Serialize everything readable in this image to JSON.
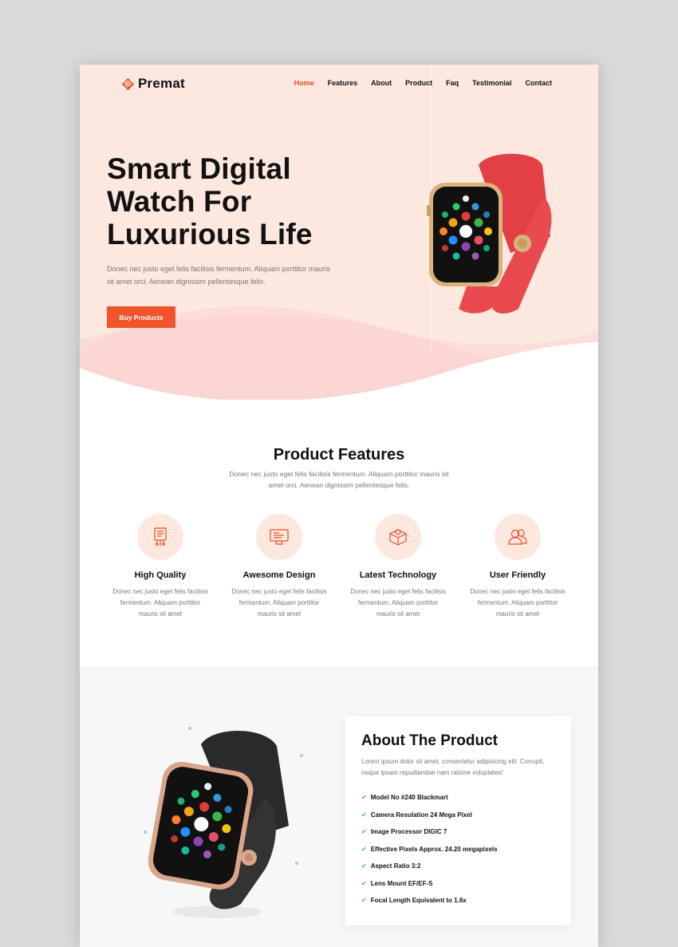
{
  "brand": {
    "name": "Premat",
    "accent": "#ee4d23"
  },
  "nav": {
    "items": [
      {
        "label": "Home",
        "active": true
      },
      {
        "label": "Features",
        "active": false
      },
      {
        "label": "About",
        "active": false
      },
      {
        "label": "Product",
        "active": false
      },
      {
        "label": "Faq",
        "active": false
      },
      {
        "label": "Testimonial",
        "active": false
      },
      {
        "label": "Contact",
        "active": false
      }
    ]
  },
  "hero": {
    "title_line1": "Smart Digital",
    "title_line2": "Watch For",
    "title_line3": "Luxurious Life",
    "description": "Donec nec justo eget felis facilisis fermentum. Aliquam porttitor mauris sit amet orci. Aenean dignissim pellentesque felis.",
    "cta_label": "Buy Products"
  },
  "features": {
    "title": "Product Features",
    "description": "Donec nec justo eget felis facilisis fermentum. Aliquam porttitor mauris sit amet orci. Aenean dignissim pellentesque felis.",
    "items": [
      {
        "icon": "chip-icon",
        "title": "High Quality",
        "description": "Donec nec justo eget felis facilisis fermentum. Aliquam porttitor mauris sit amet"
      },
      {
        "icon": "monitor-icon",
        "title": "Awesome Design",
        "description": "Donec nec justo eget felis facilisis fermentum. Aliquam porttitor mauris sit amet"
      },
      {
        "icon": "box-icon",
        "title": "Latest Technology",
        "description": "Donec nec justo eget felis facilisis fermentum. Aliquam porttitor mauris sit amet"
      },
      {
        "icon": "users-icon",
        "title": "User Friendly",
        "description": "Donec nec justo eget felis facilisis fermentum. Aliquam porttitor mauris sit amet"
      }
    ]
  },
  "about": {
    "title": "About The Product",
    "description": "Lorem ipsum dolor sit amet, consectetur adipisicing elit. Corrupti, neque ipsam repudiandae nam ratione voluptates!",
    "specs": [
      "Model No #240 Blackmart",
      "Camera Resulation 24 Mega Pixel",
      "Image Processor DIGIC 7",
      "Effective Pixels Approx. 24.20 megapixels",
      "Aspect Ratio 3:2",
      "Lens Mount EF/EF-S",
      "Focal Length Equivalent to 1.6x"
    ]
  }
}
